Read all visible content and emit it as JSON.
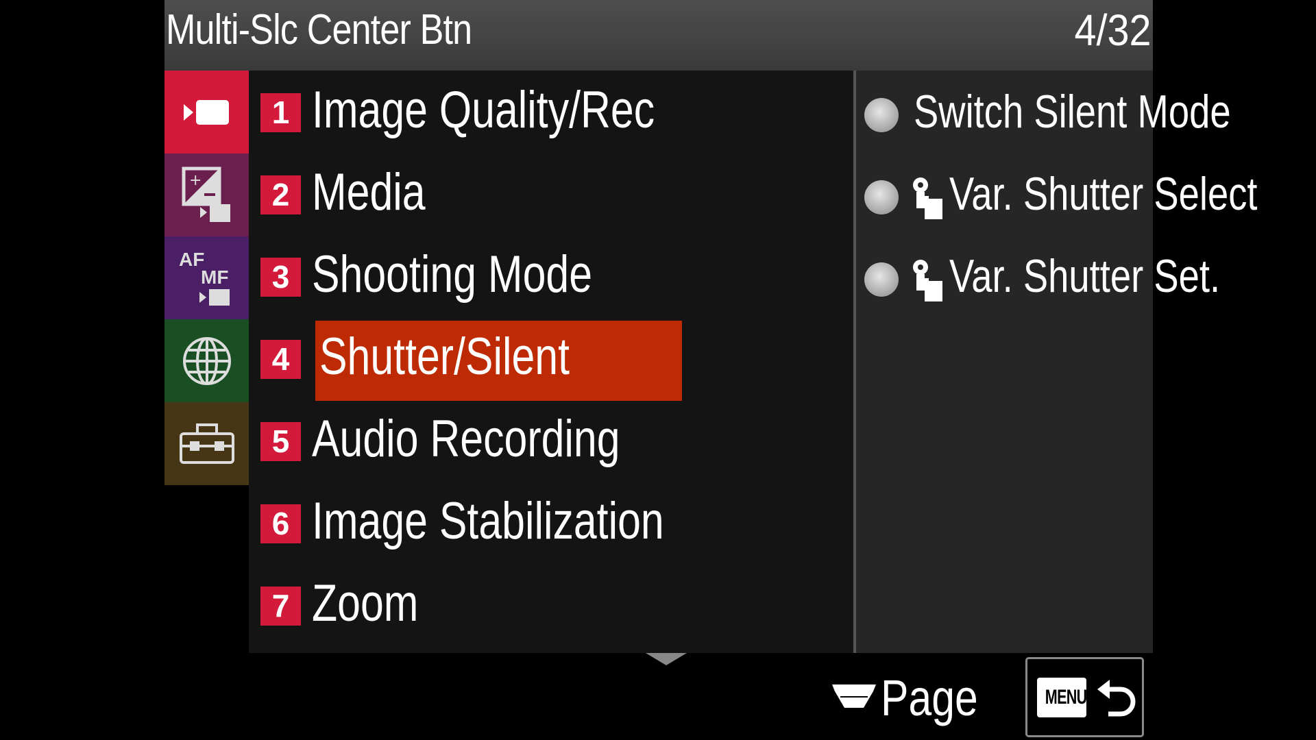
{
  "header": {
    "title": "Multi-Slc Center Btn",
    "page_indicator": "4/32"
  },
  "categories": [
    {
      "name": "movie-shooting",
      "icon": "movie-camera-icon",
      "color": "#d41a3a",
      "selected": true
    },
    {
      "name": "exposure-color",
      "icon": "exposure-movie-icon",
      "color": "#6a1f4f"
    },
    {
      "name": "focus",
      "icon": "af-mf-movie-icon",
      "color": "#4a1f66"
    },
    {
      "name": "network",
      "icon": "globe-icon",
      "color": "#1a4f23"
    },
    {
      "name": "setup",
      "icon": "toolbox-icon",
      "color": "#473616"
    }
  ],
  "menu_items": [
    {
      "number": "1",
      "label": "Image Quality/Rec"
    },
    {
      "number": "2",
      "label": "Media"
    },
    {
      "number": "3",
      "label": "Shooting Mode"
    },
    {
      "number": "4",
      "label": "Shutter/Silent",
      "selected": true
    },
    {
      "number": "5",
      "label": "Audio Recording"
    },
    {
      "number": "6",
      "label": "Image Stabilization"
    },
    {
      "number": "7",
      "label": "Zoom"
    }
  ],
  "options": [
    {
      "label": "Switch Silent Mode",
      "icon": null
    },
    {
      "label": "Var. Shutter Select",
      "icon": "custom-key-icon"
    },
    {
      "label": "Var. Shutter Set.",
      "icon": "custom-key-icon"
    }
  ],
  "footer": {
    "page_label": "Page",
    "menu_key_label": "MENU",
    "back_icon": "return-arrow-icon"
  },
  "colors": {
    "accent_red": "#d41a3a",
    "selection": "#bd2a03",
    "panel": "#141414",
    "options_panel": "#262626"
  }
}
